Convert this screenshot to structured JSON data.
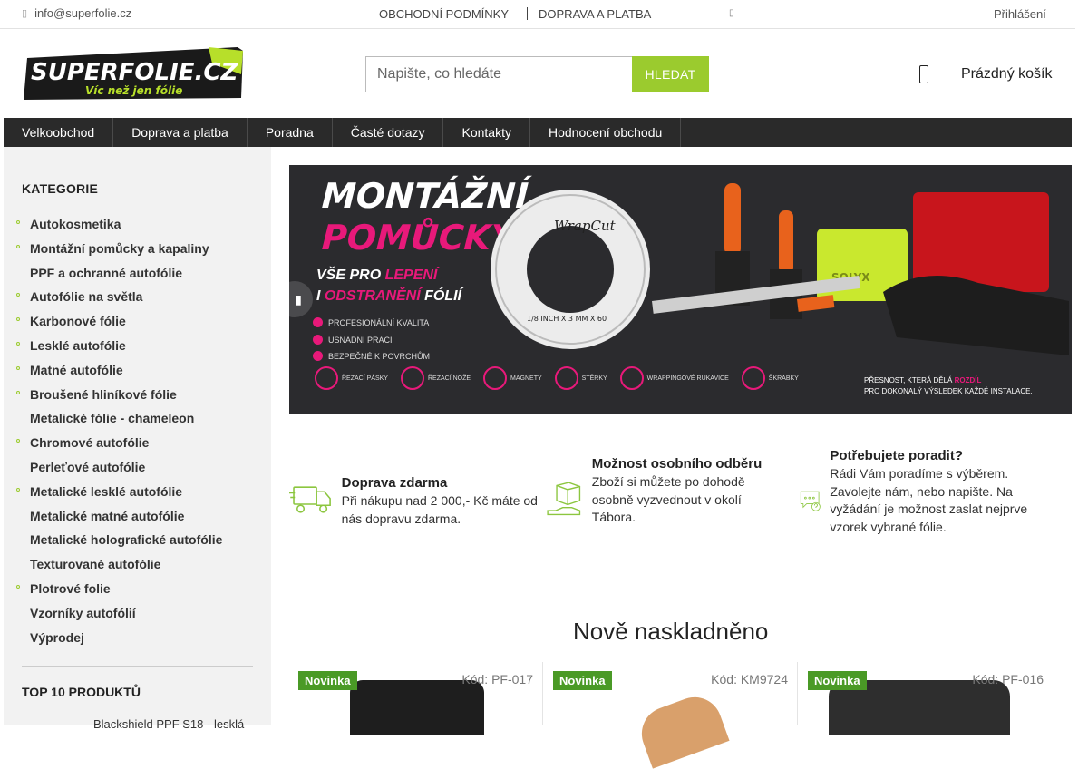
{
  "topbar": {
    "email": "info@superfolie.cz",
    "links": [
      "OBCHODNÍ PODMÍNKY",
      "DOPRAVA A PLATBA"
    ],
    "login": "Přihlášení"
  },
  "header": {
    "logo_main": "SUPERFOLIE.CZ",
    "logo_tagline": "Víc než jen fólie",
    "search_placeholder": "Napište, co hledáte",
    "search_button": "HLEDAT",
    "cart_label": "Prázdný košík"
  },
  "nav": [
    "Velkoobchod",
    "Doprava a platba",
    "Poradna",
    "Časté dotazy",
    "Kontakty",
    "Hodnocení obchodu"
  ],
  "sidebar": {
    "categories_title": "KATEGORIE",
    "categories": [
      {
        "label": "Autokosmetika",
        "has_children": true
      },
      {
        "label": "Montážní pomůcky a kapaliny",
        "has_children": true
      },
      {
        "label": "PPF a ochranné autofólie",
        "has_children": false
      },
      {
        "label": "Autofólie na světla",
        "has_children": true
      },
      {
        "label": "Karbonové fólie",
        "has_children": true
      },
      {
        "label": "Lesklé autofólie",
        "has_children": true
      },
      {
        "label": "Matné autofólie",
        "has_children": true
      },
      {
        "label": "Broušené hliníkové fólie",
        "has_children": true
      },
      {
        "label": "Metalické fólie - chameleon",
        "has_children": false
      },
      {
        "label": "Chromové autofólie",
        "has_children": true
      },
      {
        "label": "Perleťové autofólie",
        "has_children": false
      },
      {
        "label": "Metalické lesklé autofólie",
        "has_children": true
      },
      {
        "label": "Metalické matné autofólie",
        "has_children": false
      },
      {
        "label": "Metalické holografické autofólie",
        "has_children": false
      },
      {
        "label": "Texturované autofólie",
        "has_children": false
      },
      {
        "label": "Plotrové folie",
        "has_children": true
      },
      {
        "label": "Vzorníky autofólií",
        "has_children": false
      },
      {
        "label": "Výprodej",
        "has_children": false
      }
    ],
    "top_title": "TOP 10 PRODUKTŮ",
    "top_first_item": "Blackshield PPF S18 - lesklá"
  },
  "banner": {
    "line1": "MONTÁŽNÍ",
    "line2": "POMŮCKY",
    "sub1_a": "VŠE PRO ",
    "sub1_b": "LEPENÍ",
    "sub2_a": "I ",
    "sub2_b": "ODSTRANĚNÍ",
    "sub2_c": " FÓLIÍ",
    "bullets": [
      "PROFESIONÁLNÍ KVALITA",
      "USNADNÍ PRÁCI",
      "BEZPEČNÉ K POVRCHŮM"
    ],
    "icons": [
      "ŘEZACÍ PÁSKY",
      "ŘEZACÍ NOŽE",
      "MAGNETY",
      "STĚRKY",
      "WRAPPINGOVÉ RUKAVICE",
      "ŠKRABKY"
    ],
    "note_a": "PŘESNOST, KTERÁ DĚLÁ ",
    "note_b": "ROZDÍL",
    "note_c": "PRO DOKONALÝ VÝSLEDEK KAŽDÉ INSTALACE.",
    "product_tape_brand": "WrapCut",
    "product_tape_size": "1/8 INCH X 3 MM X 60",
    "product_squeegee_brand": "SOLYX",
    "accent_color": "#e8197a"
  },
  "info_blocks": [
    {
      "title": "Doprava zdarma",
      "text": "Při nákupu nad 2 000,- Kč máte od nás dopravu zdarma.",
      "icon": "truck-icon"
    },
    {
      "title": "Možnost osobního odběru",
      "text": "Zboží si můžete po dohodě osobně vyzvednout v okolí Tábora.",
      "icon": "package-hand-icon"
    },
    {
      "title": "Potřebujete poradit?",
      "text": "Rádi Vám poradíme s výběrem. Zavolejte nám, nebo napište. Na vyžádání je možnost zaslat nejprve vzorek vybrané fólie.",
      "icon": "chat-question-icon"
    }
  ],
  "new_products": {
    "title": "Nově naskladněno",
    "items": [
      {
        "badge": "Novinka",
        "code": "Kód: PF-017"
      },
      {
        "badge": "Novinka",
        "code": "Kód: KM9724"
      },
      {
        "badge": "Novinka",
        "code": "Kód: PF-016"
      }
    ]
  },
  "colors": {
    "accent_green": "#9bcb2e",
    "badge_green": "#4a9a26",
    "nav_bg": "#2a2a2a"
  }
}
